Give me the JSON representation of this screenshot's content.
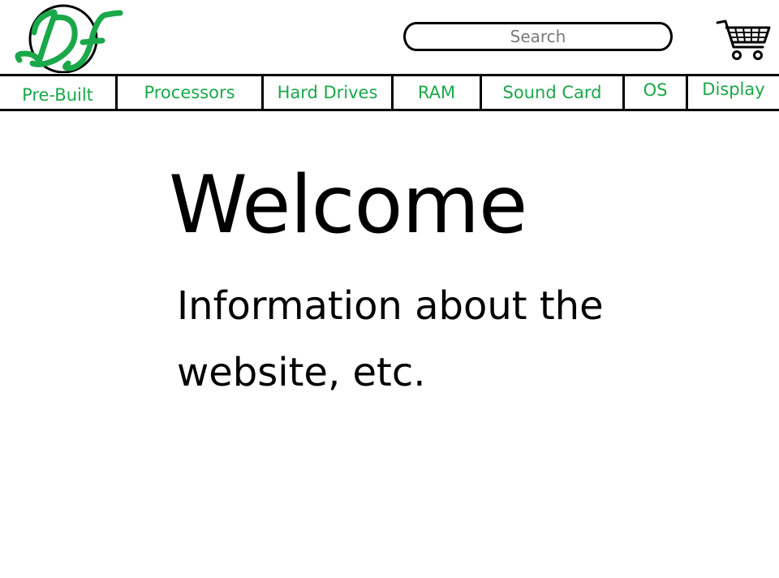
{
  "header": {
    "logo_text": "DF",
    "search": {
      "placeholder": "Search",
      "value": ""
    },
    "cart_icon": "shopping-cart-icon"
  },
  "nav": {
    "items": [
      {
        "label": "Pre-Built"
      },
      {
        "label": "Processors"
      },
      {
        "label": "Hard Drives"
      },
      {
        "label": "RAM"
      },
      {
        "label": "Sound Card"
      },
      {
        "label": "OS"
      },
      {
        "label": "Display"
      }
    ]
  },
  "main": {
    "heading": "Welcome",
    "body": "Information about the website, etc."
  },
  "colors": {
    "accent": "#1aa84a",
    "text": "#000000",
    "placeholder": "#7a7a7a"
  }
}
